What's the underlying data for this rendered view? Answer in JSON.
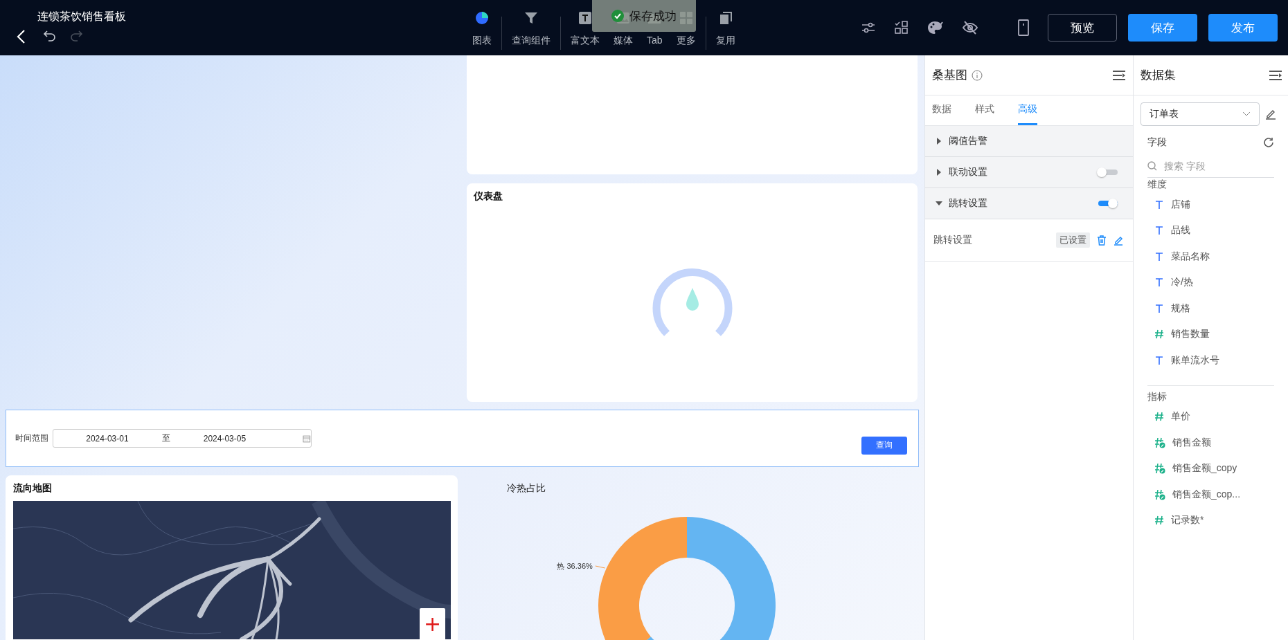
{
  "topbar": {
    "title": "连锁茶饮销售看板",
    "history": [
      {
        "kind": "undo",
        "disabled": false
      },
      {
        "kind": "redo",
        "disabled": true
      }
    ],
    "tools": [
      {
        "kind": "chart",
        "label": "图表",
        "divider_after": true
      },
      {
        "kind": "filter",
        "label": "查询组件",
        "divider_after": true
      },
      {
        "kind": "text",
        "label": "富文本",
        "divider_after": false
      },
      {
        "kind": "media",
        "label": "媒体",
        "divider_after": false
      },
      {
        "kind": "tab",
        "label": "Tab",
        "divider_after": false
      },
      {
        "kind": "more",
        "label": "更多",
        "divider_after": true
      },
      {
        "kind": "reuse",
        "label": "复用",
        "divider_after": false
      }
    ],
    "icons": [
      {
        "kind": "sliders"
      },
      {
        "kind": "checklist"
      },
      {
        "kind": "palette"
      },
      {
        "kind": "hidden"
      },
      {
        "kind": "device"
      }
    ],
    "buttons": [
      {
        "label": "预览",
        "kind": "outline"
      },
      {
        "label": "保存",
        "kind": "primary"
      },
      {
        "label": "发布",
        "kind": "primary"
      }
    ]
  },
  "toast": {
    "text": "保存成功"
  },
  "canvas": {
    "gauge_card": {
      "title": "仪表盘"
    },
    "query_bar": {
      "label": "时间范围",
      "start": "2024-03-01",
      "separator": "至",
      "end": "2024-03-05",
      "button": "查询"
    },
    "map_card": {
      "title": "流向地图",
      "zoom_button": "+"
    },
    "donut": {
      "chart_data": {
        "type": "donut",
        "title": "冷热占比",
        "values": [
          36.36,
          63.64
        ],
        "value_labels": [
          "热 36.36%",
          null
        ]
      }
    }
  },
  "props_panel": {
    "title": "桑基图",
    "tabs": [
      {
        "label": "数据",
        "selected": false
      },
      {
        "label": "样式",
        "selected": false
      },
      {
        "label": "高级",
        "selected": true
      }
    ],
    "sections": [
      {
        "title": "阈值告警",
        "kind": "plain",
        "expanded": false
      },
      {
        "title": "联动设置",
        "kind": "toggle",
        "expanded": false,
        "on": false
      },
      {
        "title": "跳转设置",
        "kind": "toggle",
        "expanded": true,
        "on": true,
        "rows": [
          {
            "label": "跳转设置",
            "status": "已设置"
          }
        ]
      }
    ]
  },
  "dataset_panel": {
    "title": "数据集",
    "source": "订单表",
    "fields_label": "字段",
    "search_placeholder": "搜索 字段",
    "groups": [
      {
        "title": "维度",
        "fields": [
          {
            "kind": "text",
            "name": "店铺"
          },
          {
            "kind": "text",
            "name": "品线"
          },
          {
            "kind": "text",
            "name": "菜品名称"
          },
          {
            "kind": "text",
            "name": "冷/热"
          },
          {
            "kind": "text",
            "name": "规格"
          },
          {
            "kind": "number",
            "name": "销售数量"
          },
          {
            "kind": "text",
            "name": "账单流水号"
          }
        ]
      },
      {
        "title": "指标",
        "fields": [
          {
            "kind": "number",
            "name": "单价"
          },
          {
            "kind": "calculated",
            "name": "销售金额"
          },
          {
            "kind": "calculated",
            "name": "销售金额_copy"
          },
          {
            "kind": "calculated",
            "name": "销售金额_cop..."
          },
          {
            "kind": "number",
            "name": "记录数*"
          }
        ]
      }
    ]
  }
}
